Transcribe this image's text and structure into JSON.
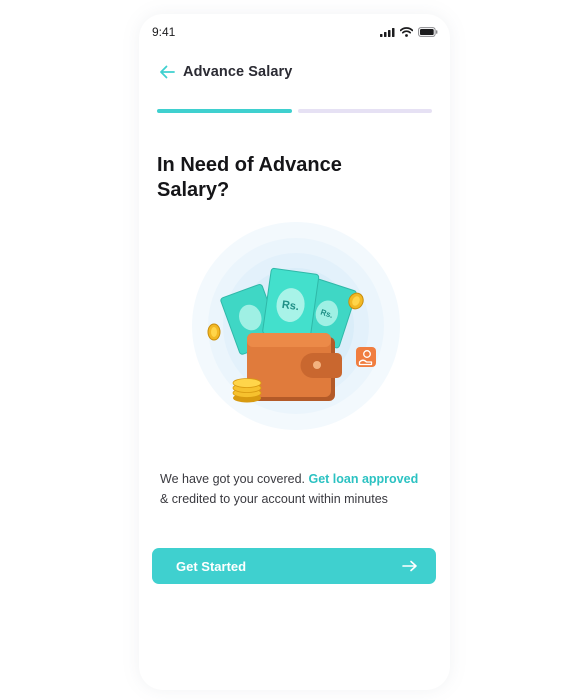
{
  "status_bar": {
    "time": "9:41",
    "icons": [
      "signal-icon",
      "wifi-icon",
      "battery-icon"
    ]
  },
  "header": {
    "back_icon": "arrow-left-icon",
    "title": "Advance Salary"
  },
  "progress": {
    "total_steps": 2,
    "current_step": 1,
    "active_color": "#3fd0cf",
    "inactive_color": "#e6e1f4"
  },
  "hero": {
    "title": "In Need of Advance Salary?"
  },
  "illustration": {
    "banknote_label": "Rs.",
    "elements": [
      "wallet-icon",
      "banknote-icon",
      "coin-stack-icon",
      "coin-icon",
      "coin-in-hand-badge-icon"
    ]
  },
  "description": {
    "text_before": "We have got you covered.",
    "highlight": "Get loan approved",
    "text_after": "& credited to your account within minutes"
  },
  "cta": {
    "label": "Get Started",
    "icon": "arrow-right-icon",
    "color": "#3fd0cf"
  }
}
